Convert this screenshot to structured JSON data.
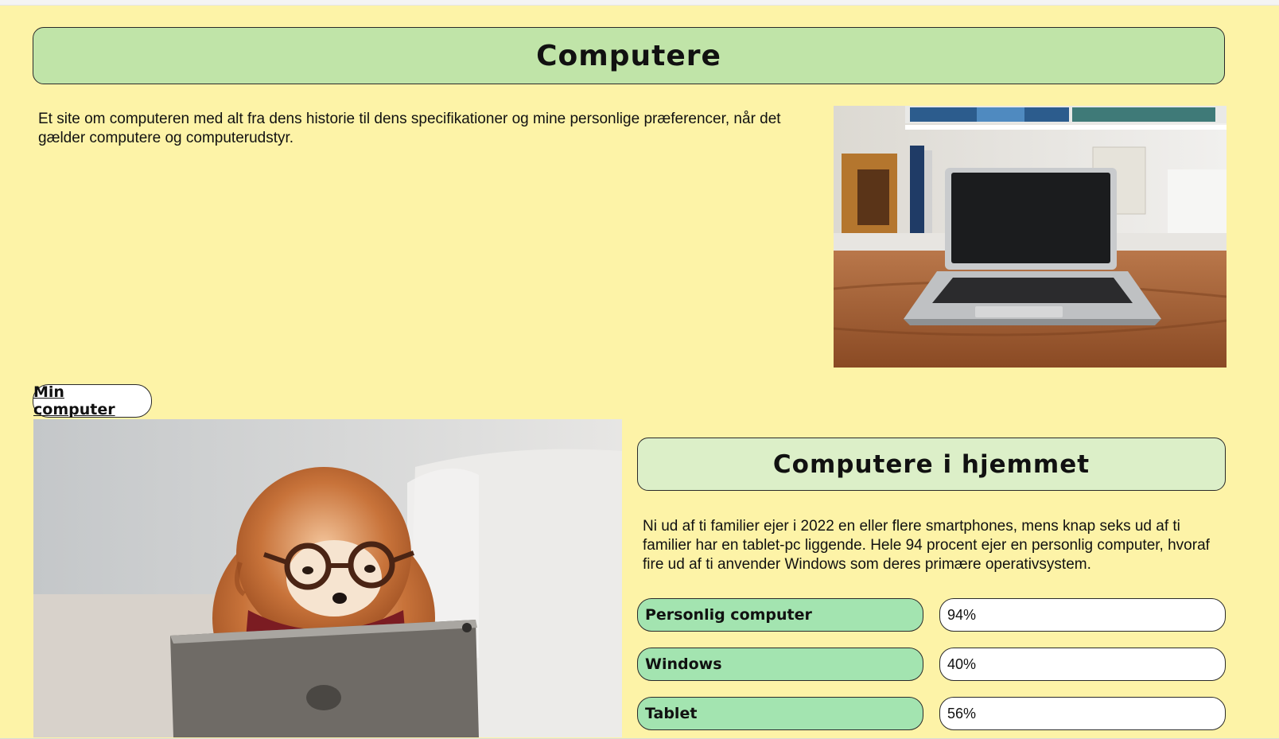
{
  "header": {
    "title": "Computere"
  },
  "intro": {
    "text": "Et site om computeren med alt fra dens historie til dens specifikationer og mine personlige præferencer, når det gælder computere og computerudstyr."
  },
  "nav": {
    "min_computer": "Min computer"
  },
  "home_section": {
    "title": "Computere i hjemmet",
    "text": "Ni ud af ti familier ejer i 2022 en eller flere smartphones, mens knap seks ud af ti familier har en tablet-pc liggende. Hele 94 procent ejer en personlig computer, hvoraf fire ud af ti anvender Windows som deres primære operativsystem.",
    "stats": [
      {
        "label": "Personlig computer",
        "value": "94%"
      },
      {
        "label": "Windows",
        "value": "40%"
      },
      {
        "label": "Tablet",
        "value": "56%"
      }
    ]
  },
  "colors": {
    "page_background": "#fdf3a7",
    "header_background": "#c0e4a8",
    "subheader_background": "#dcefc8",
    "stat_label_background": "#a3e4b0"
  }
}
